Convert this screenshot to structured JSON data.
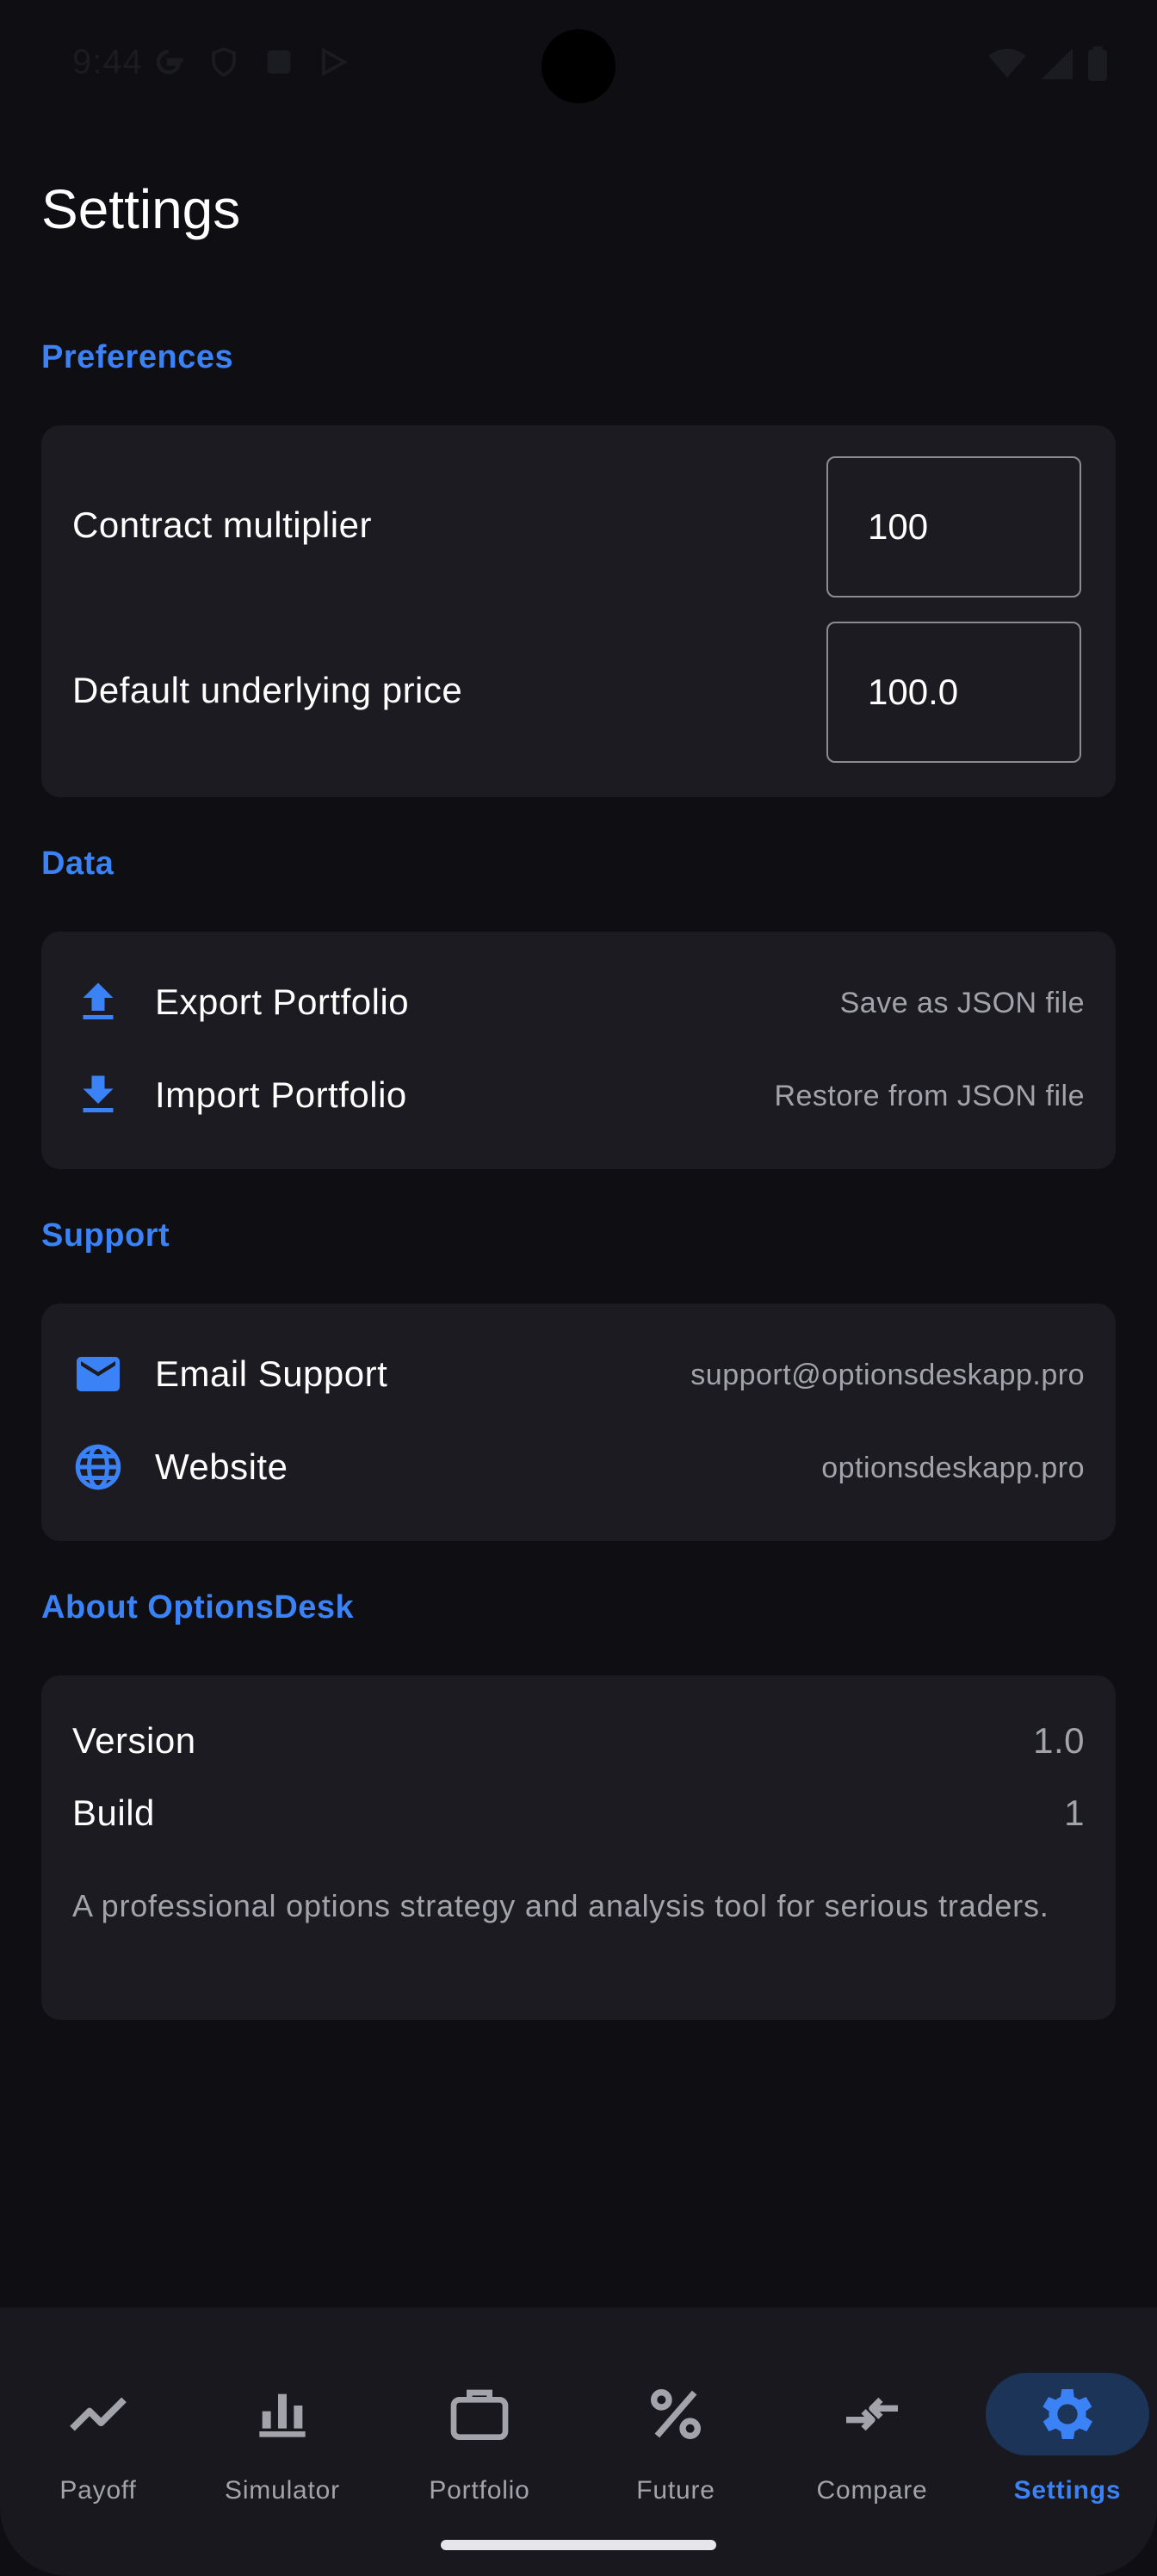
{
  "status_bar": {
    "time": "9:44"
  },
  "page": {
    "title": "Settings"
  },
  "preferences": {
    "section_title": "Preferences",
    "contract_multiplier": {
      "label": "Contract multiplier",
      "value": "100"
    },
    "default_underlying_price": {
      "label": "Default underlying price",
      "value": "100.0"
    }
  },
  "data_section": {
    "section_title": "Data",
    "export": {
      "label": "Export Portfolio",
      "detail": "Save as JSON file",
      "icon": "upload-icon"
    },
    "import": {
      "label": "Import Portfolio",
      "detail": "Restore from JSON file",
      "icon": "download-icon"
    }
  },
  "support": {
    "section_title": "Support",
    "email": {
      "label": "Email Support",
      "detail": "support@optionsdeskapp.pro",
      "icon": "mail-icon"
    },
    "website": {
      "label": "Website",
      "detail": "optionsdeskapp.pro",
      "icon": "globe-icon"
    }
  },
  "about": {
    "section_title": "About OptionsDesk",
    "version": {
      "label": "Version",
      "value": "1.0"
    },
    "build": {
      "label": "Build",
      "value": "1"
    },
    "description": "A professional options strategy and analysis tool for serious traders."
  },
  "nav": {
    "items": [
      {
        "label": "Payoff",
        "icon": "trending-icon"
      },
      {
        "label": "Simulator",
        "icon": "bar-chart-icon"
      },
      {
        "label": "Portfolio",
        "icon": "briefcase-icon"
      },
      {
        "label": "Future",
        "icon": "percent-icon"
      },
      {
        "label": "Compare",
        "icon": "compare-arrows-icon"
      },
      {
        "label": "Settings",
        "icon": "gear-icon"
      }
    ],
    "active_index": 5
  },
  "colors": {
    "accent": "#3b82f6",
    "background": "#0e0e13",
    "card": "#1b1b21",
    "muted_text": "#a3a3ab"
  }
}
